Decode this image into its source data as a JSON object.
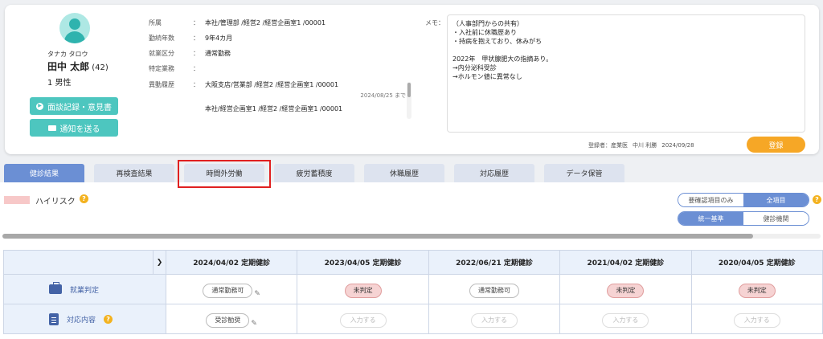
{
  "profile": {
    "kana": "タナカ タロウ",
    "name": "田中 太郎",
    "age": "(42)",
    "age_sex": "1 男性",
    "btn_interview": "面談記録・意見書",
    "btn_notify": "通知を送る"
  },
  "info": {
    "dept_label": "所属",
    "dept_value": "本社/管理部 /経営2 /経営企画室1 /00001",
    "tenure_label": "勤続年数",
    "tenure_value": "9年4カ月",
    "worktype_label": "就業区分",
    "worktype_value": "通常勤務",
    "special_label": "特定業務",
    "special_value": "",
    "history_label": "異動履歴",
    "history_1": "大阪支店/営業部 /経営2 /経営企画室1 /00001",
    "history_1_date": "2024/08/25 まで",
    "history_2": "本社/経営企画室1 /経営2 /経営企画室1 /00001",
    "colon": "："
  },
  "memo": {
    "label": "メモ：",
    "text": "（人事部門からの共有）\n・入社前に休職歴あり\n・持病を抱えており、休みがち\n\n2022年　甲状腺肥大の指摘あり。\n→内分泌科受診\n→ホルモン値に異常なし",
    "registrar_label": "登録者：産業医",
    "registrar_name": "中川 利勝",
    "registrar_date": "2024/09/28",
    "register_button": "登録"
  },
  "tabs": [
    "健診結果",
    "再検査結果",
    "時間外労働",
    "疲労蓄積度",
    "休職履歴",
    "対応履歴",
    "データ保管"
  ],
  "legend": {
    "high_risk": "ハイリスク",
    "help": "?"
  },
  "filters": {
    "needs_check_only": "要確認項目のみ",
    "all_items": "全項目",
    "unified_standard": "統一基準",
    "clinic": "健診機関"
  },
  "table": {
    "columns": [
      "2024/04/02 定期健診",
      "2023/04/05 定期健診",
      "2022/06/21 定期健診",
      "2021/04/02 定期健診",
      "2020/04/05 定期健診"
    ],
    "row1_label": "就業判定",
    "row1": [
      "通常勤務可",
      "未判定",
      "通常勤務可",
      "未判定",
      "未判定"
    ],
    "row2_label": "対応内容",
    "row2": [
      "受診勧奨",
      "入力する",
      "入力する",
      "入力する",
      "入力する"
    ]
  },
  "colors": {
    "teal": "#4dc6bf",
    "blue": "#6b8fd4",
    "orange": "#f6a726",
    "pink": "#f7c8c8",
    "highlight": "#e02020"
  }
}
